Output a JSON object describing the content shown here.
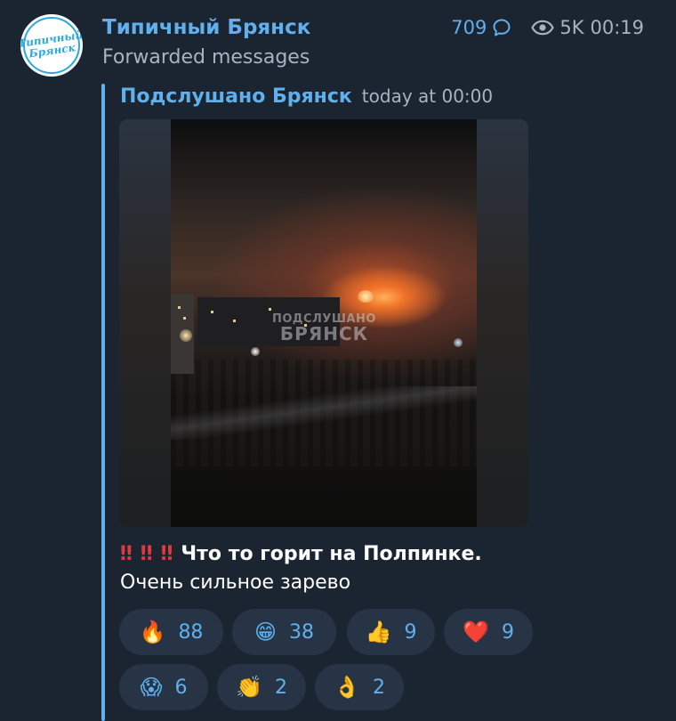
{
  "header": {
    "channel_name": "Типичный Брянск",
    "subtitle": "Forwarded messages",
    "avatar_text": "Типичный Брянск",
    "comments_count": "709",
    "views": "5K",
    "time": "00:19"
  },
  "forwarded": {
    "source": "Подслушано Брянск",
    "time": "today at 00:00"
  },
  "media": {
    "watermark_line1": "ПОДСЛУШАНО",
    "watermark_line2": "БРЯНСК"
  },
  "message": {
    "emphasis_mark": "‼",
    "bold_text": "Что то горит на Полпинке.",
    "plain_text": "Очень сильное зарево"
  },
  "reactions": [
    {
      "emoji": "🔥",
      "count": "88"
    },
    {
      "emoji": "😁",
      "count": "38"
    },
    {
      "emoji": "👍",
      "count": "9"
    },
    {
      "emoji": "❤️",
      "count": "9"
    },
    {
      "emoji": "😱",
      "count": "6"
    },
    {
      "emoji": "👏",
      "count": "2"
    },
    {
      "emoji": "👌",
      "count": "2"
    }
  ],
  "colors": {
    "background": "#1b2431",
    "accent": "#5fb0ec",
    "muted_text": "#a8b3c1",
    "reaction_bg": "#263446"
  }
}
